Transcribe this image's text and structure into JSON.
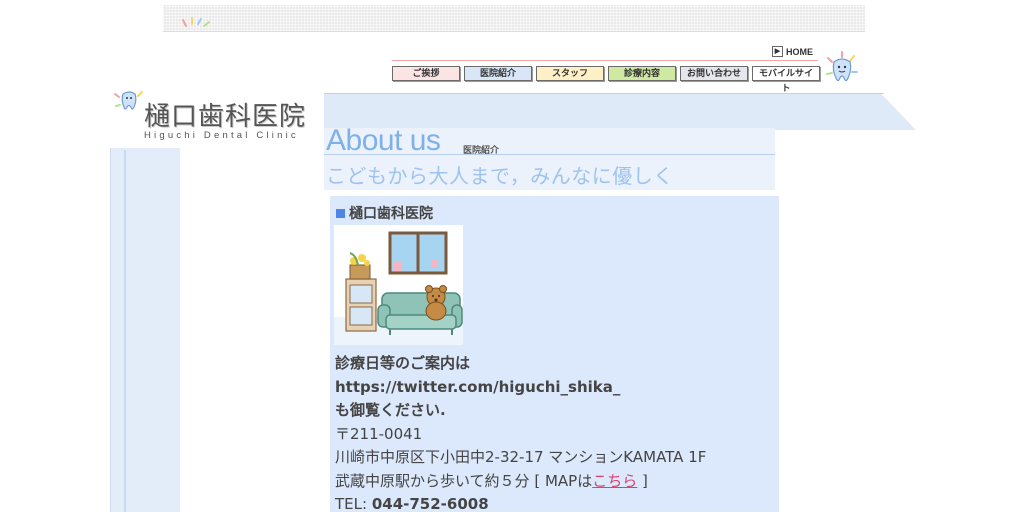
{
  "header": {
    "home_label": "HOME",
    "nav": [
      {
        "label": "ご挨拶",
        "color": "#fbe4e4",
        "width": 68
      },
      {
        "label": "医院紹介",
        "color": "#d8e6f8",
        "width": 68
      },
      {
        "label": "スタッフ",
        "color": "#fdf0c6",
        "width": 68
      },
      {
        "label": "診療内容",
        "color": "#cfe9a3",
        "width": 68
      },
      {
        "label": "お問い合わせ",
        "color": "#e6e6ee",
        "width": 68
      },
      {
        "label": "モバイルサイト",
        "color": "#ffffff",
        "width": 68
      }
    ]
  },
  "logo": {
    "title": "樋口歯科医院",
    "subtitle": "Higuchi Dental Clinic"
  },
  "page": {
    "title": "About us",
    "title_sub": "医院紹介",
    "tagline": "こどもから大人まで，みんなに優しく"
  },
  "clinic": {
    "heading": "樋口歯科医院",
    "info_line1": "診療日等のご案内は",
    "info_line2": "https://twitter.com/higuchi_shika_",
    "info_line3": "も御覧ください.",
    "postal": "〒211-0041",
    "address": "川崎市中原区下小田中2-32-17 マンションKAMATA 1F",
    "access_prefix": "武蔵中原駅から歩いて約５分 [ MAPは",
    "map_link": "こちら",
    "access_suffix": " ]",
    "tel_label": "TEL: ",
    "tel": "044-752-6008"
  },
  "colors": {
    "accent": "#7fb0ea",
    "content_bg": "#dce8fb",
    "link": "#e0406a"
  }
}
